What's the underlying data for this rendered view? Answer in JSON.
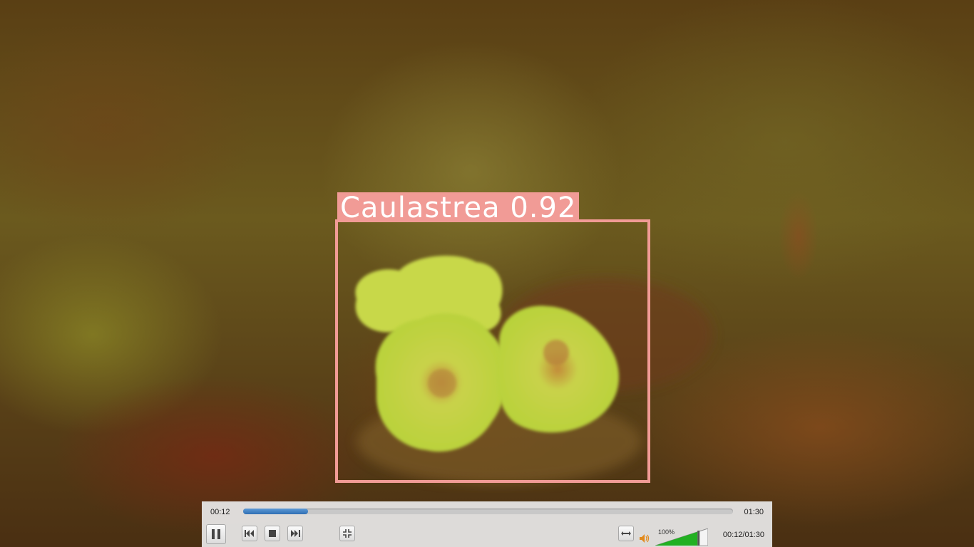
{
  "video": {
    "detection": {
      "class_name": "Caulastrea",
      "confidence": "0.92",
      "label_text": "Caulastrea 0.92",
      "box_color": "#f19b96"
    }
  },
  "controls": {
    "elapsed": "00:12",
    "total": "01:30",
    "progress_fraction": 0.133,
    "volume_percent_label": "100%",
    "volume_level": 1.0,
    "time_status": "00:12/01:30",
    "accent_color": "#2f6eb3",
    "volume_color": "#22b022",
    "icons": {
      "pause": "pause-icon",
      "previous": "skip-previous-icon",
      "stop": "stop-icon",
      "next": "skip-next-icon",
      "fullscreen": "fullscreen-icon",
      "extended": "extended-settings-icon",
      "volume": "speaker-icon"
    }
  }
}
